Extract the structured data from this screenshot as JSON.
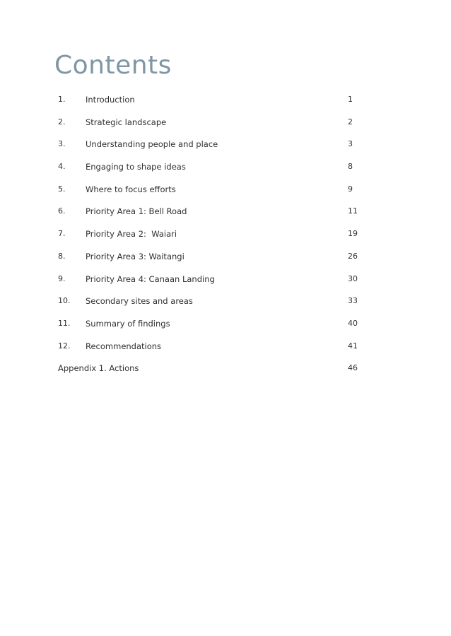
{
  "page": {
    "title": "Contents",
    "title_color": "#7f96a4"
  },
  "toc": {
    "entries": [
      {
        "number": "1.",
        "label": "Introduction",
        "page": "1"
      },
      {
        "number": "2.",
        "label": "Strategic landscape",
        "page": "2"
      },
      {
        "number": "3.",
        "label": "Understanding people and place",
        "page": "3"
      },
      {
        "number": "4.",
        "label": "Engaging to shape ideas",
        "page": "8"
      },
      {
        "number": "5.",
        "label": "Where to focus efforts",
        "page": "9"
      },
      {
        "number": "6.",
        "label": "Priority Area 1: Bell Road",
        "page": "11"
      },
      {
        "number": "7.",
        "label": "Priority Area 2:  Waiari",
        "page": "19"
      },
      {
        "number": "8.",
        "label": "Priority Area 3: Waitangi",
        "page": "26"
      },
      {
        "number": "9.",
        "label": "Priority Area 4: Canaan Landing",
        "page": "30"
      },
      {
        "number": "10.",
        "label": "Secondary sites and areas",
        "page": "33"
      },
      {
        "number": "11.",
        "label": "Summary of findings",
        "page": "40"
      },
      {
        "number": "12.",
        "label": "Recommendations",
        "page": "41"
      }
    ],
    "appendix": {
      "label": "Appendix 1. Actions",
      "page": "46"
    }
  }
}
